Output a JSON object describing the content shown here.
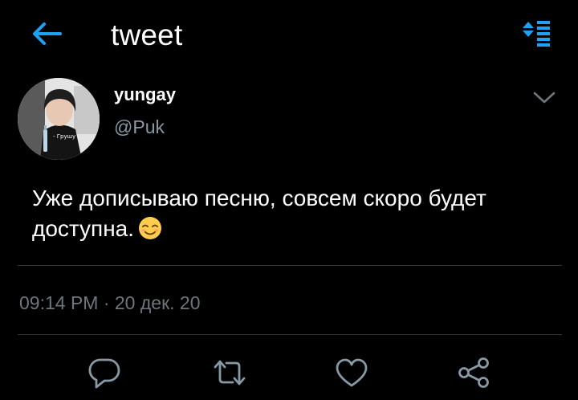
{
  "header": {
    "title": "tweet",
    "back_icon": "arrow-left-icon",
    "sort_icon": "sort-list-icon",
    "accent_color": "#1da1f2"
  },
  "tweet": {
    "display_name": "yungay",
    "handle": "@Puk",
    "avatar_caption": "- Грушу",
    "text": "Уже дописываю песню, совсем скоро будет доступна.",
    "emoji": "relieved-face-emoji",
    "timestamp": "09:14 PM · 20 дек. 20",
    "menu_icon": "chevron-down-icon"
  },
  "actions": {
    "reply_icon": "reply-icon",
    "retweet_icon": "retweet-icon",
    "like_icon": "heart-icon",
    "share_icon": "share-icon"
  },
  "colors": {
    "background": "#000000",
    "secondary_text": "#8899a6",
    "divider": "#2f3336"
  }
}
